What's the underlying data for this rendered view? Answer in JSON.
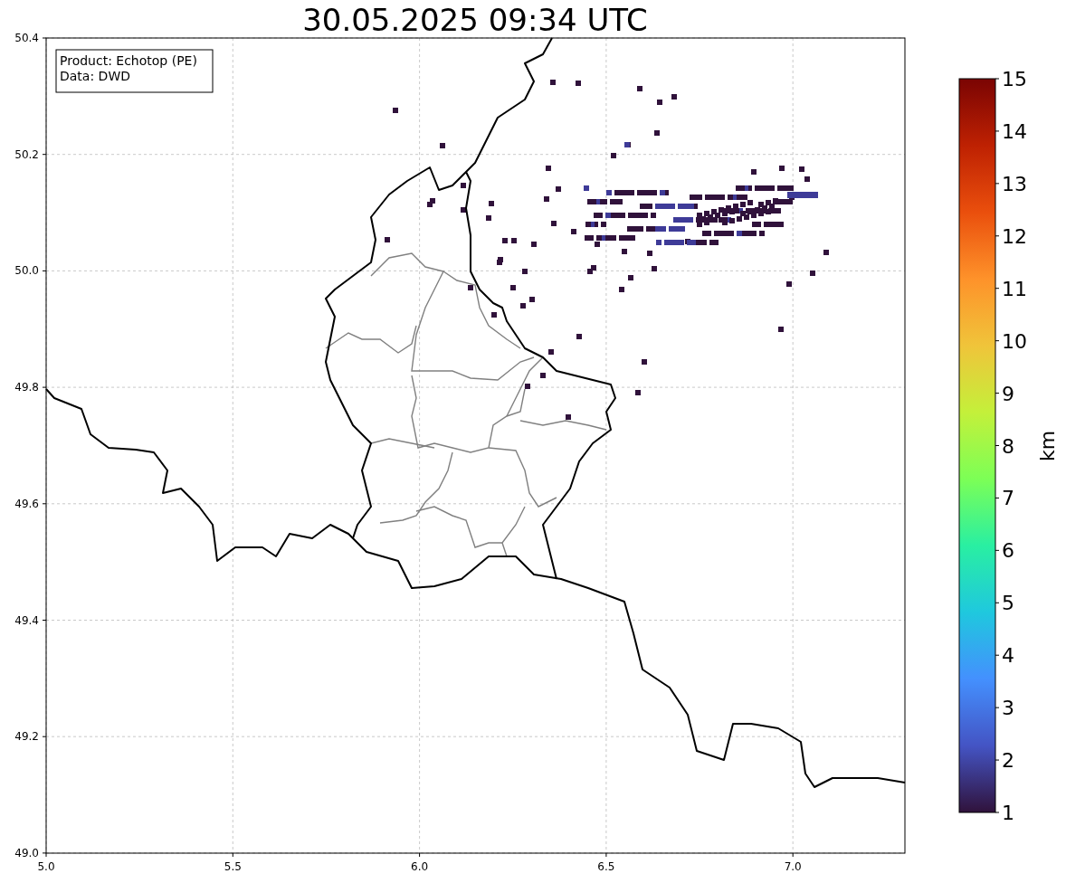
{
  "title": "30.05.2025 09:34 UTC",
  "info_box": {
    "lines": [
      "Product: Echotop (PE)",
      "Data: DWD"
    ]
  },
  "map": {
    "x_ticks": [
      "5.0",
      "5.5",
      "6.0",
      "6.5",
      "7.0"
    ],
    "y_ticks": [
      "50.4",
      "50.2",
      "50.0",
      "49.8",
      "49.6",
      "49.4",
      "49.2",
      "49.0"
    ]
  },
  "colorbar": {
    "label": "km",
    "ticks": [
      "15",
      "14",
      "13",
      "12",
      "11",
      "10",
      "9",
      "8",
      "7",
      "6",
      "5",
      "4",
      "3",
      "2",
      "1"
    ]
  }
}
